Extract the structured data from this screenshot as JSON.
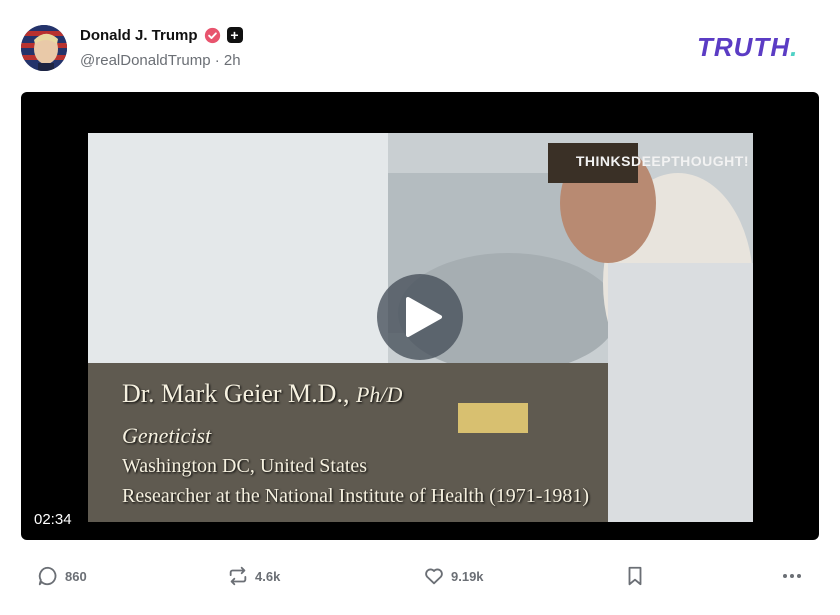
{
  "post": {
    "author_name": "Donald J. Trump",
    "handle": "@realDonaldTrump",
    "separator": "·",
    "time_ago": "2h"
  },
  "brand": {
    "logo_text": "TRUTH",
    "logo_dot": ".",
    "accent_color": "#5b3cc4",
    "dot_color": "#4fd1c5"
  },
  "video": {
    "duration": "02:34",
    "watermark": "THINKSDEEPTHOUGHT!",
    "caption_name": "Dr. Mark Geier M.D.,",
    "caption_degree": "Ph/D",
    "caption_title": "Geneticist",
    "caption_location": "Washington DC, United States",
    "caption_role": "Researcher at the National Institute of Health (1971-1981)"
  },
  "actions": {
    "replies": "860",
    "retruths": "4.6k",
    "likes": "9.19k"
  },
  "icons": [
    "verified-badge-icon",
    "plus-badge-icon",
    "play-icon",
    "reply-icon",
    "retruth-icon",
    "like-icon",
    "bookmark-icon",
    "more-icon"
  ]
}
